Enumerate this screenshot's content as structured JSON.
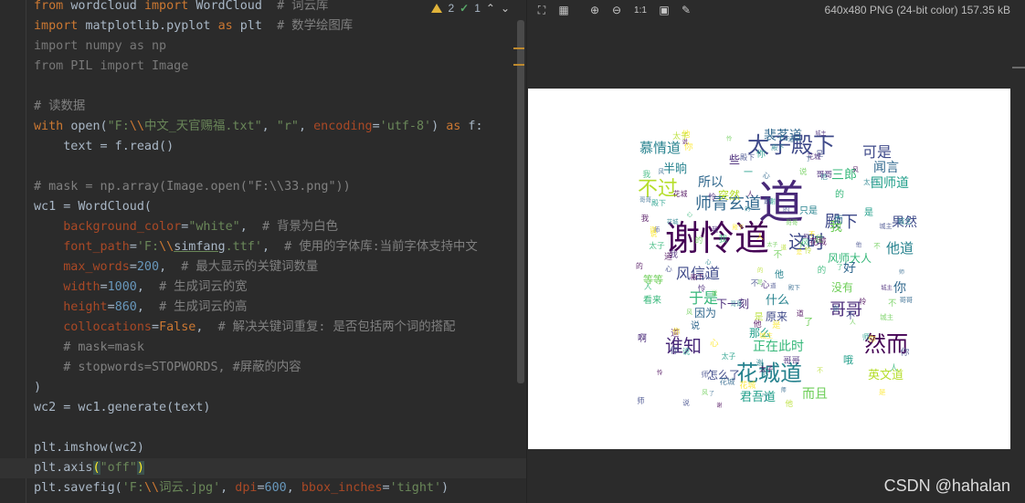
{
  "editor": {
    "lines": [
      {
        "segments": [
          {
            "t": "kw",
            "v": "from "
          },
          {
            "t": "",
            "v": "wordcloud "
          },
          {
            "t": "kw",
            "v": "import "
          },
          {
            "t": "",
            "v": "WordCloud  "
          },
          {
            "t": "cm",
            "v": "# 词云库"
          }
        ]
      },
      {
        "segments": [
          {
            "t": "kw",
            "v": "import "
          },
          {
            "t": "",
            "v": "matplotlib.pyplot "
          },
          {
            "t": "kw",
            "v": "as "
          },
          {
            "t": "",
            "v": "plt  "
          },
          {
            "t": "cm",
            "v": "# 数学绘图库"
          }
        ]
      },
      {
        "segments": [
          {
            "t": "unused",
            "v": "import numpy as np"
          }
        ]
      },
      {
        "segments": [
          {
            "t": "unused",
            "v": "from PIL import Image"
          }
        ]
      },
      {
        "segments": []
      },
      {
        "segments": [
          {
            "t": "cm",
            "v": "# 读数据"
          }
        ]
      },
      {
        "segments": [
          {
            "t": "kw",
            "v": "with "
          },
          {
            "t": "",
            "v": "open("
          },
          {
            "t": "str",
            "v": "\"F:"
          },
          {
            "t": "esc",
            "v": "\\\\"
          },
          {
            "t": "str",
            "v": "中文_天官赐福.txt\""
          },
          {
            "t": "",
            "v": ", "
          },
          {
            "t": "str",
            "v": "\"r\""
          },
          {
            "t": "",
            "v": ", "
          },
          {
            "t": "prm",
            "v": "encoding"
          },
          {
            "t": "",
            "v": "="
          },
          {
            "t": "str",
            "v": "'utf-8'"
          },
          {
            "t": "",
            "v": ") "
          },
          {
            "t": "kw",
            "v": "as "
          },
          {
            "t": "",
            "v": "f:"
          }
        ]
      },
      {
        "segments": [
          {
            "t": "",
            "v": "    text = f.read()"
          }
        ]
      },
      {
        "segments": []
      },
      {
        "segments": [
          {
            "t": "cm",
            "v": "# mask = np.array(Image.open(\"F:\\\\33.png\"))"
          }
        ]
      },
      {
        "segments": [
          {
            "t": "",
            "v": "wc1 = WordCloud("
          }
        ]
      },
      {
        "segments": [
          {
            "t": "",
            "v": "    "
          },
          {
            "t": "prm",
            "v": "background_color"
          },
          {
            "t": "",
            "v": "="
          },
          {
            "t": "str",
            "v": "\"white\""
          },
          {
            "t": "",
            "v": ",  "
          },
          {
            "t": "cm",
            "v": "# 背景为白色"
          }
        ]
      },
      {
        "segments": [
          {
            "t": "",
            "v": "    "
          },
          {
            "t": "prm",
            "v": "font_path"
          },
          {
            "t": "",
            "v": "="
          },
          {
            "t": "str",
            "v": "'F:"
          },
          {
            "t": "esc",
            "v": "\\\\"
          },
          {
            "t": "ul",
            "v": "simfang"
          },
          {
            "t": "str",
            "v": ".ttf'"
          },
          {
            "t": "",
            "v": ",  "
          },
          {
            "t": "cm",
            "v": "# 使用的字体库:当前字体支持中文"
          }
        ]
      },
      {
        "segments": [
          {
            "t": "",
            "v": "    "
          },
          {
            "t": "prm",
            "v": "max_words"
          },
          {
            "t": "",
            "v": "="
          },
          {
            "t": "num",
            "v": "200"
          },
          {
            "t": "",
            "v": ",  "
          },
          {
            "t": "cm",
            "v": "# 最大显示的关键词数量"
          }
        ]
      },
      {
        "segments": [
          {
            "t": "",
            "v": "    "
          },
          {
            "t": "prm",
            "v": "width"
          },
          {
            "t": "",
            "v": "="
          },
          {
            "t": "num",
            "v": "1000"
          },
          {
            "t": "",
            "v": ",  "
          },
          {
            "t": "cm",
            "v": "# 生成词云的宽"
          }
        ]
      },
      {
        "segments": [
          {
            "t": "",
            "v": "    "
          },
          {
            "t": "prm",
            "v": "height"
          },
          {
            "t": "",
            "v": "="
          },
          {
            "t": "num",
            "v": "860"
          },
          {
            "t": "",
            "v": ",  "
          },
          {
            "t": "cm",
            "v": "# 生成词云的高"
          }
        ]
      },
      {
        "segments": [
          {
            "t": "",
            "v": "    "
          },
          {
            "t": "prm",
            "v": "collocations"
          },
          {
            "t": "",
            "v": "="
          },
          {
            "t": "kw",
            "v": "False"
          },
          {
            "t": "",
            "v": ",  "
          },
          {
            "t": "cm",
            "v": "# 解决关键词重复: 是否包括两个词的搭配"
          }
        ]
      },
      {
        "segments": [
          {
            "t": "",
            "v": "    "
          },
          {
            "t": "cm",
            "v": "# mask=mask"
          }
        ]
      },
      {
        "segments": [
          {
            "t": "",
            "v": "    "
          },
          {
            "t": "cm",
            "v": "# stopwords=STOPWORDS, #屏蔽的内容"
          }
        ]
      },
      {
        "segments": [
          {
            "t": "",
            "v": ")"
          }
        ]
      },
      {
        "segments": [
          {
            "t": "",
            "v": "wc2 = wc1.generate(text)"
          }
        ]
      },
      {
        "segments": []
      },
      {
        "segments": [
          {
            "t": "",
            "v": "plt.imshow(wc2)"
          }
        ]
      },
      {
        "segments": [
          {
            "t": "",
            "v": "plt.axis"
          },
          {
            "t": "paren",
            "v": "("
          },
          {
            "t": "str",
            "v": "\"off\""
          },
          {
            "t": "paren",
            "v": ")"
          }
        ],
        "current": true
      },
      {
        "segments": [
          {
            "t": "",
            "v": "plt.savefig("
          },
          {
            "t": "str",
            "v": "'F:"
          },
          {
            "t": "esc",
            "v": "\\\\"
          },
          {
            "t": "str",
            "v": "词云.jpg'"
          },
          {
            "t": "",
            "v": ", "
          },
          {
            "t": "prm",
            "v": "dpi"
          },
          {
            "t": "",
            "v": "="
          },
          {
            "t": "num",
            "v": "600"
          },
          {
            "t": "",
            "v": ", "
          },
          {
            "t": "prm",
            "v": "bbox_inches"
          },
          {
            "t": "",
            "v": "="
          },
          {
            "t": "str",
            "v": "'tight'"
          },
          {
            "t": "",
            "v": ")"
          }
        ]
      }
    ],
    "inspection": {
      "warnings": "2",
      "ok": "1"
    }
  },
  "viewer": {
    "info": "640x480 PNG (24-bit color) 157.35 kB",
    "zoom_label": "1:1",
    "icons": [
      "fit-screen-icon",
      "grid-icon",
      "zoom-in-icon",
      "zoom-out-icon",
      "actual-size-icon",
      "background-icon",
      "color-picker-icon"
    ]
  },
  "wordcloud": {
    "words": [
      "道",
      "谢怜道",
      "太子殿下",
      "花城道",
      "然而",
      "谁知",
      "这时",
      "哥哥",
      "殿下",
      "师青玄道",
      "风信道",
      "不过",
      "慕情道",
      "裴茗道",
      "可是",
      "国师道",
      "闻言",
      "所以",
      "半晌",
      "于是",
      "正在此时",
      "而且",
      "君吾道",
      "他道",
      "你",
      "好",
      "三郎",
      "些",
      "果然",
      "我",
      "什么",
      "那么",
      "原来",
      "因为",
      "下一刻",
      "风师大人",
      "没有",
      "突然",
      "怎么了",
      "而",
      "只是",
      "是",
      "的",
      "了",
      "不",
      "说",
      "他",
      "一",
      "啊",
      "看来",
      "等等",
      "英文道",
      "哦"
    ],
    "colors": [
      "#440154",
      "#482878",
      "#3e4989",
      "#31688e",
      "#26828e",
      "#1f9e89",
      "#35b779",
      "#6ece58",
      "#b5de2b",
      "#fde725"
    ]
  },
  "watermark": "CSDN @hahalan"
}
